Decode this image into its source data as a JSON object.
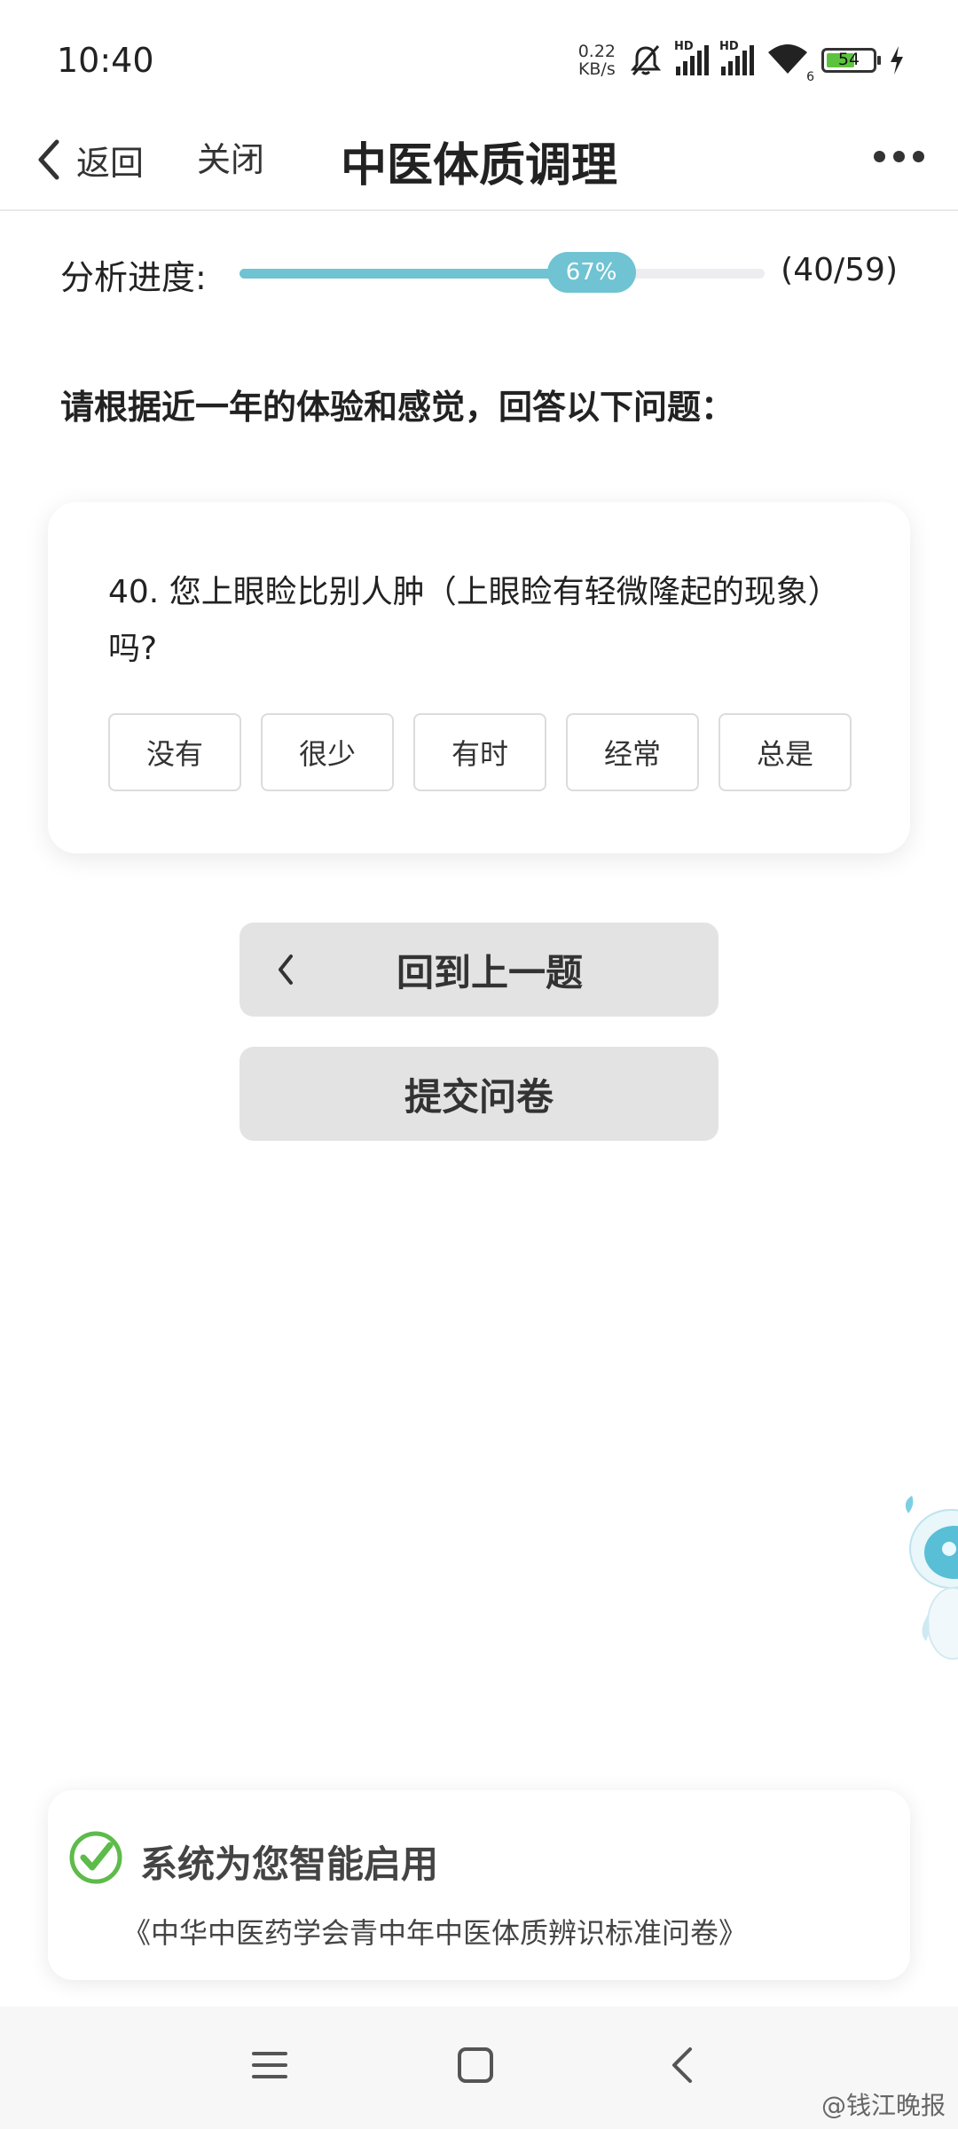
{
  "status_bar": {
    "time": "10:40",
    "net_speed_value": "0.22",
    "net_speed_unit": "KB/s",
    "signal_1_label": "HD",
    "signal_2_label": "HD",
    "wifi_label": "6",
    "battery": "54",
    "icons": [
      "mute-icon",
      "signal-icon",
      "wifi-icon",
      "battery-icon",
      "charging-icon"
    ]
  },
  "navbar": {
    "back_label": "返回",
    "close_label": "关闭",
    "title": "中医体质调理"
  },
  "progress": {
    "label": "分析进度:",
    "percent_label": "67%",
    "fraction": 0.67,
    "count": "(40/59)"
  },
  "instruction": "请根据近一年的体验和感觉，回答以下问题：",
  "question": {
    "text": "40. 您上眼睑比别人肿（上眼睑有轻微隆起的现象）吗?",
    "options": [
      "没有",
      "很少",
      "有时",
      "经常",
      "总是"
    ]
  },
  "buttons": {
    "previous": "回到上一题",
    "submit": "提交问卷"
  },
  "notice": {
    "title": "系统为您智能启用",
    "subtitle": "《中华中医药学会青中年中医体质辨识标准问卷》"
  },
  "watermark": "@钱江晚报",
  "colors": {
    "accent": "#6fc3d2",
    "check": "#5dbb4a",
    "button_bg": "#e3e3e3"
  }
}
